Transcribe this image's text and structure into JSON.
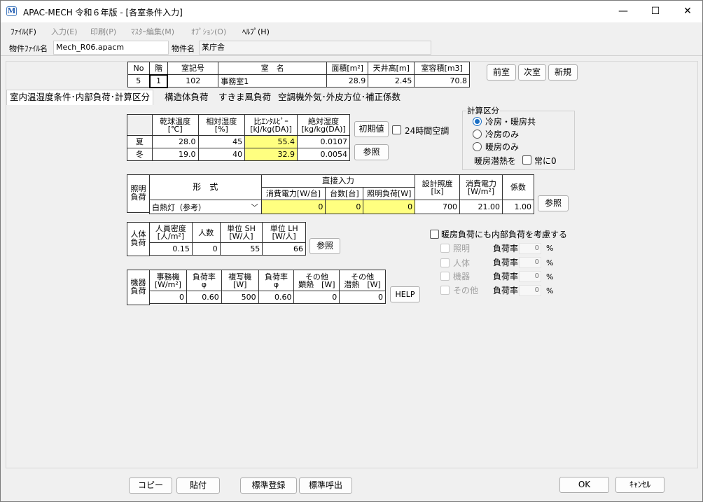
{
  "window": {
    "title": "APAC-MECH 令和６年版 - [各室条件入力]",
    "minimize": "—",
    "maximize": "☐",
    "close": "✕"
  },
  "menu": [
    "ﾌｧｲﾙ(F)",
    "入力(E)",
    "印刷(P)",
    "ﾏｽﾀｰ編集(M)",
    "ｵﾌﾟｼｮﾝ(O)",
    "ﾍﾙﾌﾟ(H)"
  ],
  "info": {
    "file_label": "物件ﾌｧｲﾙ名",
    "file_value": "Mech_R06.apacm",
    "name_label": "物件名",
    "name_value": "某庁舎"
  },
  "room": {
    "headers": [
      "No",
      "階",
      "室記号",
      "室　名",
      "面積[m²]",
      "天井高[m]",
      "室容積[m3]"
    ],
    "values": [
      "5",
      "1",
      "102",
      "事務室1",
      "28.9",
      "2.45",
      "70.8"
    ]
  },
  "nav": {
    "prev": "前室",
    "next": "次室",
    "new": "新規"
  },
  "tabs": [
    "室内温湿度条件･内部負荷･計算区分",
    "構造体負荷",
    "すきま風負荷",
    "空調機外気･外皮方位･補正係数"
  ],
  "climate": {
    "headers": [
      "乾球温度\n[℃]",
      "相対湿度\n[%]",
      "比ｴﾝﾀﾙﾋﾟｰ\n[kJ/kg(DA)]",
      "絶対湿度\n[kg/kg(DA)]"
    ],
    "summer": {
      "label": "夏",
      "values": [
        "28.0",
        "45",
        "55.4",
        "0.0107"
      ]
    },
    "winter": {
      "label": "冬",
      "values": [
        "19.0",
        "40",
        "32.9",
        "0.0054"
      ]
    },
    "init_btn": "初期値",
    "ref_btn": "参照",
    "h24_label": "24時間空調"
  },
  "calc": {
    "title": "計算区分",
    "options": [
      "冷房・暖房共",
      "冷房のみ",
      "暖房のみ"
    ],
    "latent_label": "暖房潜熱を",
    "always_zero": "常に0"
  },
  "lighting": {
    "side_label": "照明\n負荷",
    "form_header": "形　式",
    "direct_header": "直接入力",
    "sub_headers": [
      "消費電力[W/台]",
      "台数[台]",
      "照明負荷[W]"
    ],
    "illum_header": "設計照度\n[lx]",
    "power_header": "消費電力\n[W/m²]",
    "coef_header": "係数",
    "form_value": "白熱灯（参考）",
    "values": [
      "0",
      "0",
      "0",
      "700",
      "21.00",
      "1.00"
    ],
    "ref_btn": "参照"
  },
  "people": {
    "side_label": "人体\n負荷",
    "headers": [
      "人員密度\n[人/m²]",
      "人数",
      "単位 SH\n[W/人]",
      "単位 LH\n[W/人]"
    ],
    "values": [
      "0.15",
      "0",
      "55",
      "66"
    ],
    "ref_btn": "参照"
  },
  "equipment": {
    "side_label": "機器\n負荷",
    "headers": [
      "事務機\n[W/m²]",
      "負荷率\nφ",
      "複写機\n[W]",
      "負荷率\nφ",
      "その他\n顕熱　[W]",
      "その他\n潜熱　[W]"
    ],
    "values": [
      "0",
      "0.60",
      "500",
      "0.60",
      "0",
      "0"
    ],
    "help_btn": "HELP"
  },
  "heating": {
    "check_label": "暖房負荷にも内部負荷を考慮する",
    "rows": [
      {
        "name": "照明",
        "rate_label": "負荷率",
        "value": "0",
        "unit": "%"
      },
      {
        "name": "人体",
        "rate_label": "負荷率",
        "value": "0",
        "unit": "%"
      },
      {
        "name": "機器",
        "rate_label": "負荷率",
        "value": "0",
        "unit": "%"
      },
      {
        "name": "その他",
        "rate_label": "負荷率",
        "value": "0",
        "unit": "%"
      }
    ]
  },
  "footer": {
    "copy": "コピー",
    "paste": "貼付",
    "std_save": "標準登録",
    "std_load": "標準呼出",
    "ok": "OK",
    "cancel": "ｷｬﾝｾﾙ"
  }
}
